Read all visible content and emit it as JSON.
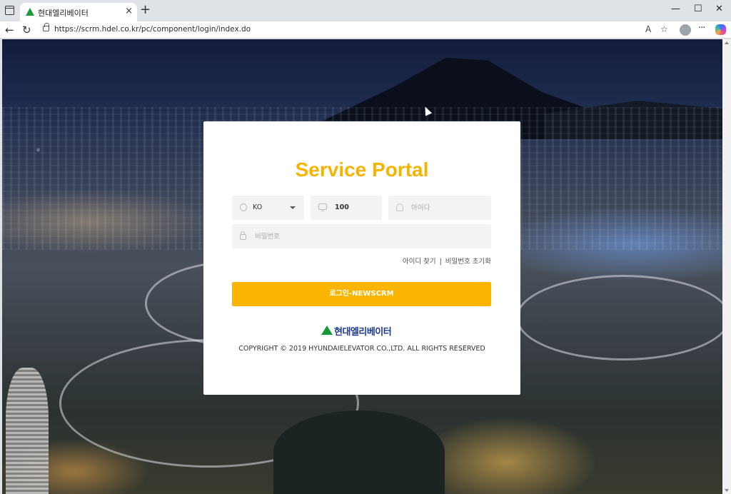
{
  "browser": {
    "tab_title": "현대엘리베이터",
    "tab_close_icon": "×",
    "new_tab_icon": "+",
    "url": "https://scrm.hdel.co.kr/pc/component/login/index.do",
    "back_icon": "←",
    "reload_icon": "↻",
    "read_aloud_icon": "A",
    "favorite_icon": "☆",
    "more_icon": "···",
    "minimize_icon": "—",
    "maximize_icon": "☐",
    "close_icon": "✕"
  },
  "login": {
    "title": "Service Portal",
    "language": {
      "value": "KO"
    },
    "company": {
      "value": "100"
    },
    "user_id": {
      "placeholder": "아이디"
    },
    "password": {
      "placeholder": "비밀번호"
    },
    "find_id": "아이디 찾기",
    "separator": "|",
    "reset_password": "비밀번호 초기화",
    "login_button": "로그인-NEWSCRM",
    "logo_text": "현대엘리베이터",
    "copyright": "COPYRIGHT © 2019 HYUNDAIELEVATOR CO.,LTD. ALL RIGHTS RESERVED"
  },
  "colors": {
    "accent": "#fbb400",
    "title": "#f5b400",
    "logo_green": "#159a38",
    "logo_blue": "#1b3a8c"
  }
}
